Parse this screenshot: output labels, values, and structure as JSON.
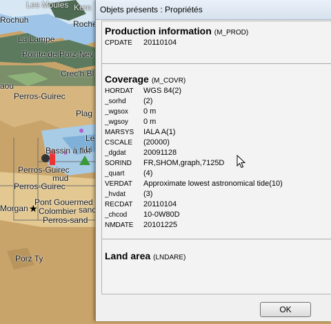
{
  "map": {
    "labels": [
      {
        "text": "Les Moules",
        "cls": "dark"
      },
      {
        "text": "Kern",
        "cls": "dark"
      },
      {
        "text": "Rochuh",
        "cls": ""
      },
      {
        "text": "Roche",
        "cls": ""
      },
      {
        "text": "La Lampe",
        "cls": ""
      },
      {
        "text": "Pointe de Porz-Nev",
        "cls": ""
      },
      {
        "text": "Crec'h Bl",
        "cls": ""
      },
      {
        "text": "aou",
        "cls": ""
      },
      {
        "text": "Perros-Guirec",
        "cls": ""
      },
      {
        "text": "Plag",
        "cls": ""
      },
      {
        "text": "Bassin à flot",
        "cls": ""
      },
      {
        "text": "Perros-Guirec",
        "cls": ""
      },
      {
        "text": "mud",
        "cls": ""
      },
      {
        "text": "Perros-Guirec",
        "cls": ""
      },
      {
        "text": "Pont Gouermed",
        "cls": ""
      },
      {
        "text": "Morgan",
        "cls": ""
      },
      {
        "text": "Colombier",
        "cls": ""
      },
      {
        "text": "sand",
        "cls": ""
      },
      {
        "text": "Perros-sand",
        "cls": ""
      },
      {
        "text": "Porz Ty",
        "cls": ""
      },
      {
        "text": "Le",
        "cls": ""
      },
      {
        "text": "Li",
        "cls": ""
      }
    ]
  },
  "dialog": {
    "title": "Objets présents : Propriétés",
    "sections": [
      {
        "title": "Production information",
        "code": "(M_PROD)",
        "rows": [
          {
            "key": "CPDATE",
            "value": "20110104"
          }
        ]
      },
      {
        "title": "Coverage",
        "code": "(M_COVR)",
        "rows": [
          {
            "key": "HORDAT",
            "value": "WGS 84(2)"
          },
          {
            "key": "_sorhd",
            "value": "(2)"
          },
          {
            "key": "_wgsox",
            "value": "0 m"
          },
          {
            "key": "_wgsoy",
            "value": "0 m"
          },
          {
            "key": "MARSYS",
            "value": "IALA A(1)"
          },
          {
            "key": "CSCALE",
            "value": "(20000)"
          },
          {
            "key": "_dgdat",
            "value": "20091128"
          },
          {
            "key": "SORIND",
            "value": "FR,SHOM,graph,7125D"
          },
          {
            "key": "_quart",
            "value": "(4)"
          },
          {
            "key": "VERDAT",
            "value": "Approximate lowest astronomical tide(10)"
          },
          {
            "key": "_hvdat",
            "value": "(3)"
          },
          {
            "key": "RECDAT",
            "value": "20110104"
          },
          {
            "key": "_chcod",
            "value": "10-0W80D"
          },
          {
            "key": "NMDATE",
            "value": "20101225"
          }
        ]
      },
      {
        "title": "Land area",
        "code": "(LNDARE)",
        "rows": []
      }
    ],
    "ok_label": "OK"
  }
}
